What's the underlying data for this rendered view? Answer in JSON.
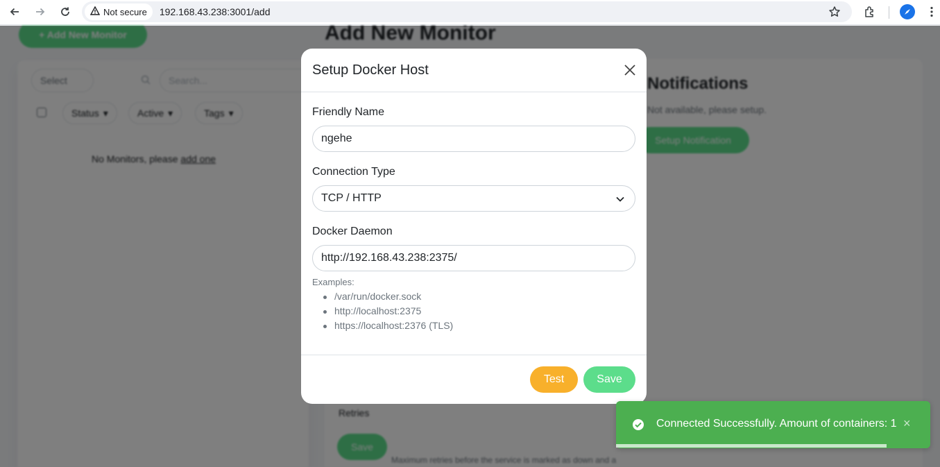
{
  "browser": {
    "security_label": "Not secure",
    "url": "192.168.43.238:3001/add"
  },
  "background": {
    "add_monitor_label": "+ Add New Monitor",
    "page_title": "Add New Monitor",
    "select_label": "Select",
    "search_placeholder": "Search...",
    "filters": [
      "Status",
      "Active",
      "Tags"
    ],
    "no_monitors_text": "No Monitors, please ",
    "add_one_link": "add one",
    "notifications_title": "Notifications",
    "notifications_sub": "Not available, please setup.",
    "setup_notification_label": "Setup Notification",
    "retries_label": "Retries",
    "save_label": "Save",
    "retries_hint": "Maximum retries before the service is marked as down and a"
  },
  "modal": {
    "title": "Setup Docker Host",
    "friendly_name_label": "Friendly Name",
    "friendly_name_value": "ngehe",
    "connection_type_label": "Connection Type",
    "connection_type_value": "TCP / HTTP",
    "docker_daemon_label": "Docker Daemon",
    "docker_daemon_value": "http://192.168.43.238:2375/",
    "examples_label": "Examples:",
    "examples": [
      "/var/run/docker.sock",
      "http://localhost:2375",
      "https://localhost:2376 (TLS)"
    ],
    "test_label": "Test",
    "save_label": "Save"
  },
  "toast": {
    "message": "Connected Successfully. Amount of containers: 1",
    "close": "×",
    "progress": 0.86
  },
  "colors": {
    "primary_green": "#5cdd8b",
    "warning": "#f8b02b",
    "toast_green": "#4caf50"
  }
}
